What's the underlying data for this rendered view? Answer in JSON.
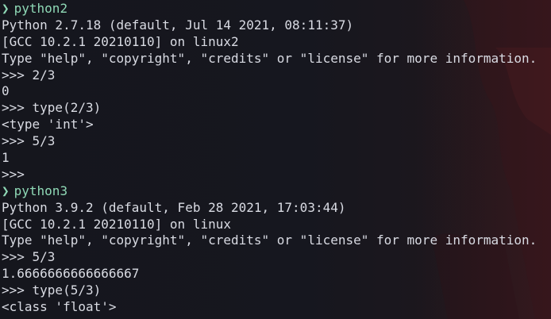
{
  "terminal": {
    "colors": {
      "background": "#16171f",
      "text": "#d9dbe3",
      "prompt": "#8fd9b6",
      "wallpaper_accent": "#5a1e26"
    },
    "prompt_glyph": "❯",
    "lines": [
      {
        "kind": "prompt",
        "text": "python2"
      },
      {
        "kind": "output",
        "text": "Python 2.7.18 (default, Jul 14 2021, 08:11:37)"
      },
      {
        "kind": "output",
        "text": "[GCC 10.2.1 20210110] on linux2"
      },
      {
        "kind": "output",
        "text": "Type \"help\", \"copyright\", \"credits\" or \"license\" for more information."
      },
      {
        "kind": "output",
        "text": ">>> 2/3"
      },
      {
        "kind": "output",
        "text": "0"
      },
      {
        "kind": "output",
        "text": ">>> type(2/3)"
      },
      {
        "kind": "output",
        "text": "<type 'int'>"
      },
      {
        "kind": "output",
        "text": ">>> 5/3"
      },
      {
        "kind": "output",
        "text": "1"
      },
      {
        "kind": "output",
        "text": ">>>"
      },
      {
        "kind": "prompt",
        "text": "python3"
      },
      {
        "kind": "output",
        "text": "Python 3.9.2 (default, Feb 28 2021, 17:03:44)"
      },
      {
        "kind": "output",
        "text": "[GCC 10.2.1 20210110] on linux"
      },
      {
        "kind": "output",
        "text": "Type \"help\", \"copyright\", \"credits\" or \"license\" for more information."
      },
      {
        "kind": "output",
        "text": ">>> 5/3"
      },
      {
        "kind": "output",
        "text": "1.6666666666666667"
      },
      {
        "kind": "output",
        "text": ">>> type(5/3)"
      },
      {
        "kind": "output",
        "text": "<class 'float'>"
      }
    ]
  }
}
